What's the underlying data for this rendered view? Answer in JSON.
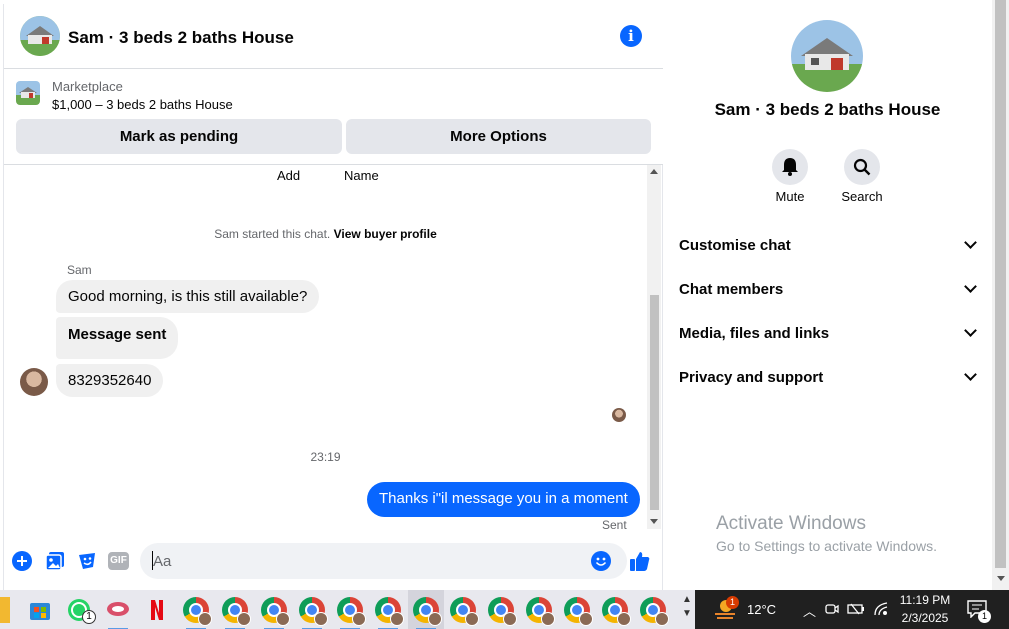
{
  "chat": {
    "title": "Sam · 3 beds 2 baths House",
    "info_icon": "i",
    "marketplace": {
      "label": "Marketplace",
      "title": "$1,000 – 3 beds 2 baths House",
      "mark_pending": "Mark as pending",
      "more_options": "More Options"
    },
    "top_labels": [
      "Add",
      "Name"
    ],
    "system_prefix": "Sam started this chat.",
    "system_link": "View buyer profile",
    "sender": "Sam",
    "messages_in": [
      "Good morning, is this still available?",
      "Message sent",
      "8329352640"
    ],
    "timestamp": "23:19",
    "message_out": "Thanks i\"il message you in a moment",
    "status": "Sent",
    "composer": {
      "placeholder": "Aa",
      "gif_label": "GIF"
    }
  },
  "side": {
    "title": "Sam · 3 beds 2 baths House",
    "mute": "Mute",
    "search": "Search",
    "sections": [
      "Customise chat",
      "Chat members",
      "Media, files and links",
      "Privacy and support"
    ]
  },
  "watermark": {
    "line1": "Activate Windows",
    "line2": "Go to Settings to activate Windows."
  },
  "taskbar": {
    "whatsapp_badge": "1",
    "weather_badge": "1",
    "temperature": "12°C",
    "time": "11:19 PM",
    "date": "2/3/2025",
    "notif_count": "1"
  },
  "colors": {
    "accent": "#0866ff",
    "bubble_in": "#f0f0f0",
    "taskbar": "#202020"
  }
}
